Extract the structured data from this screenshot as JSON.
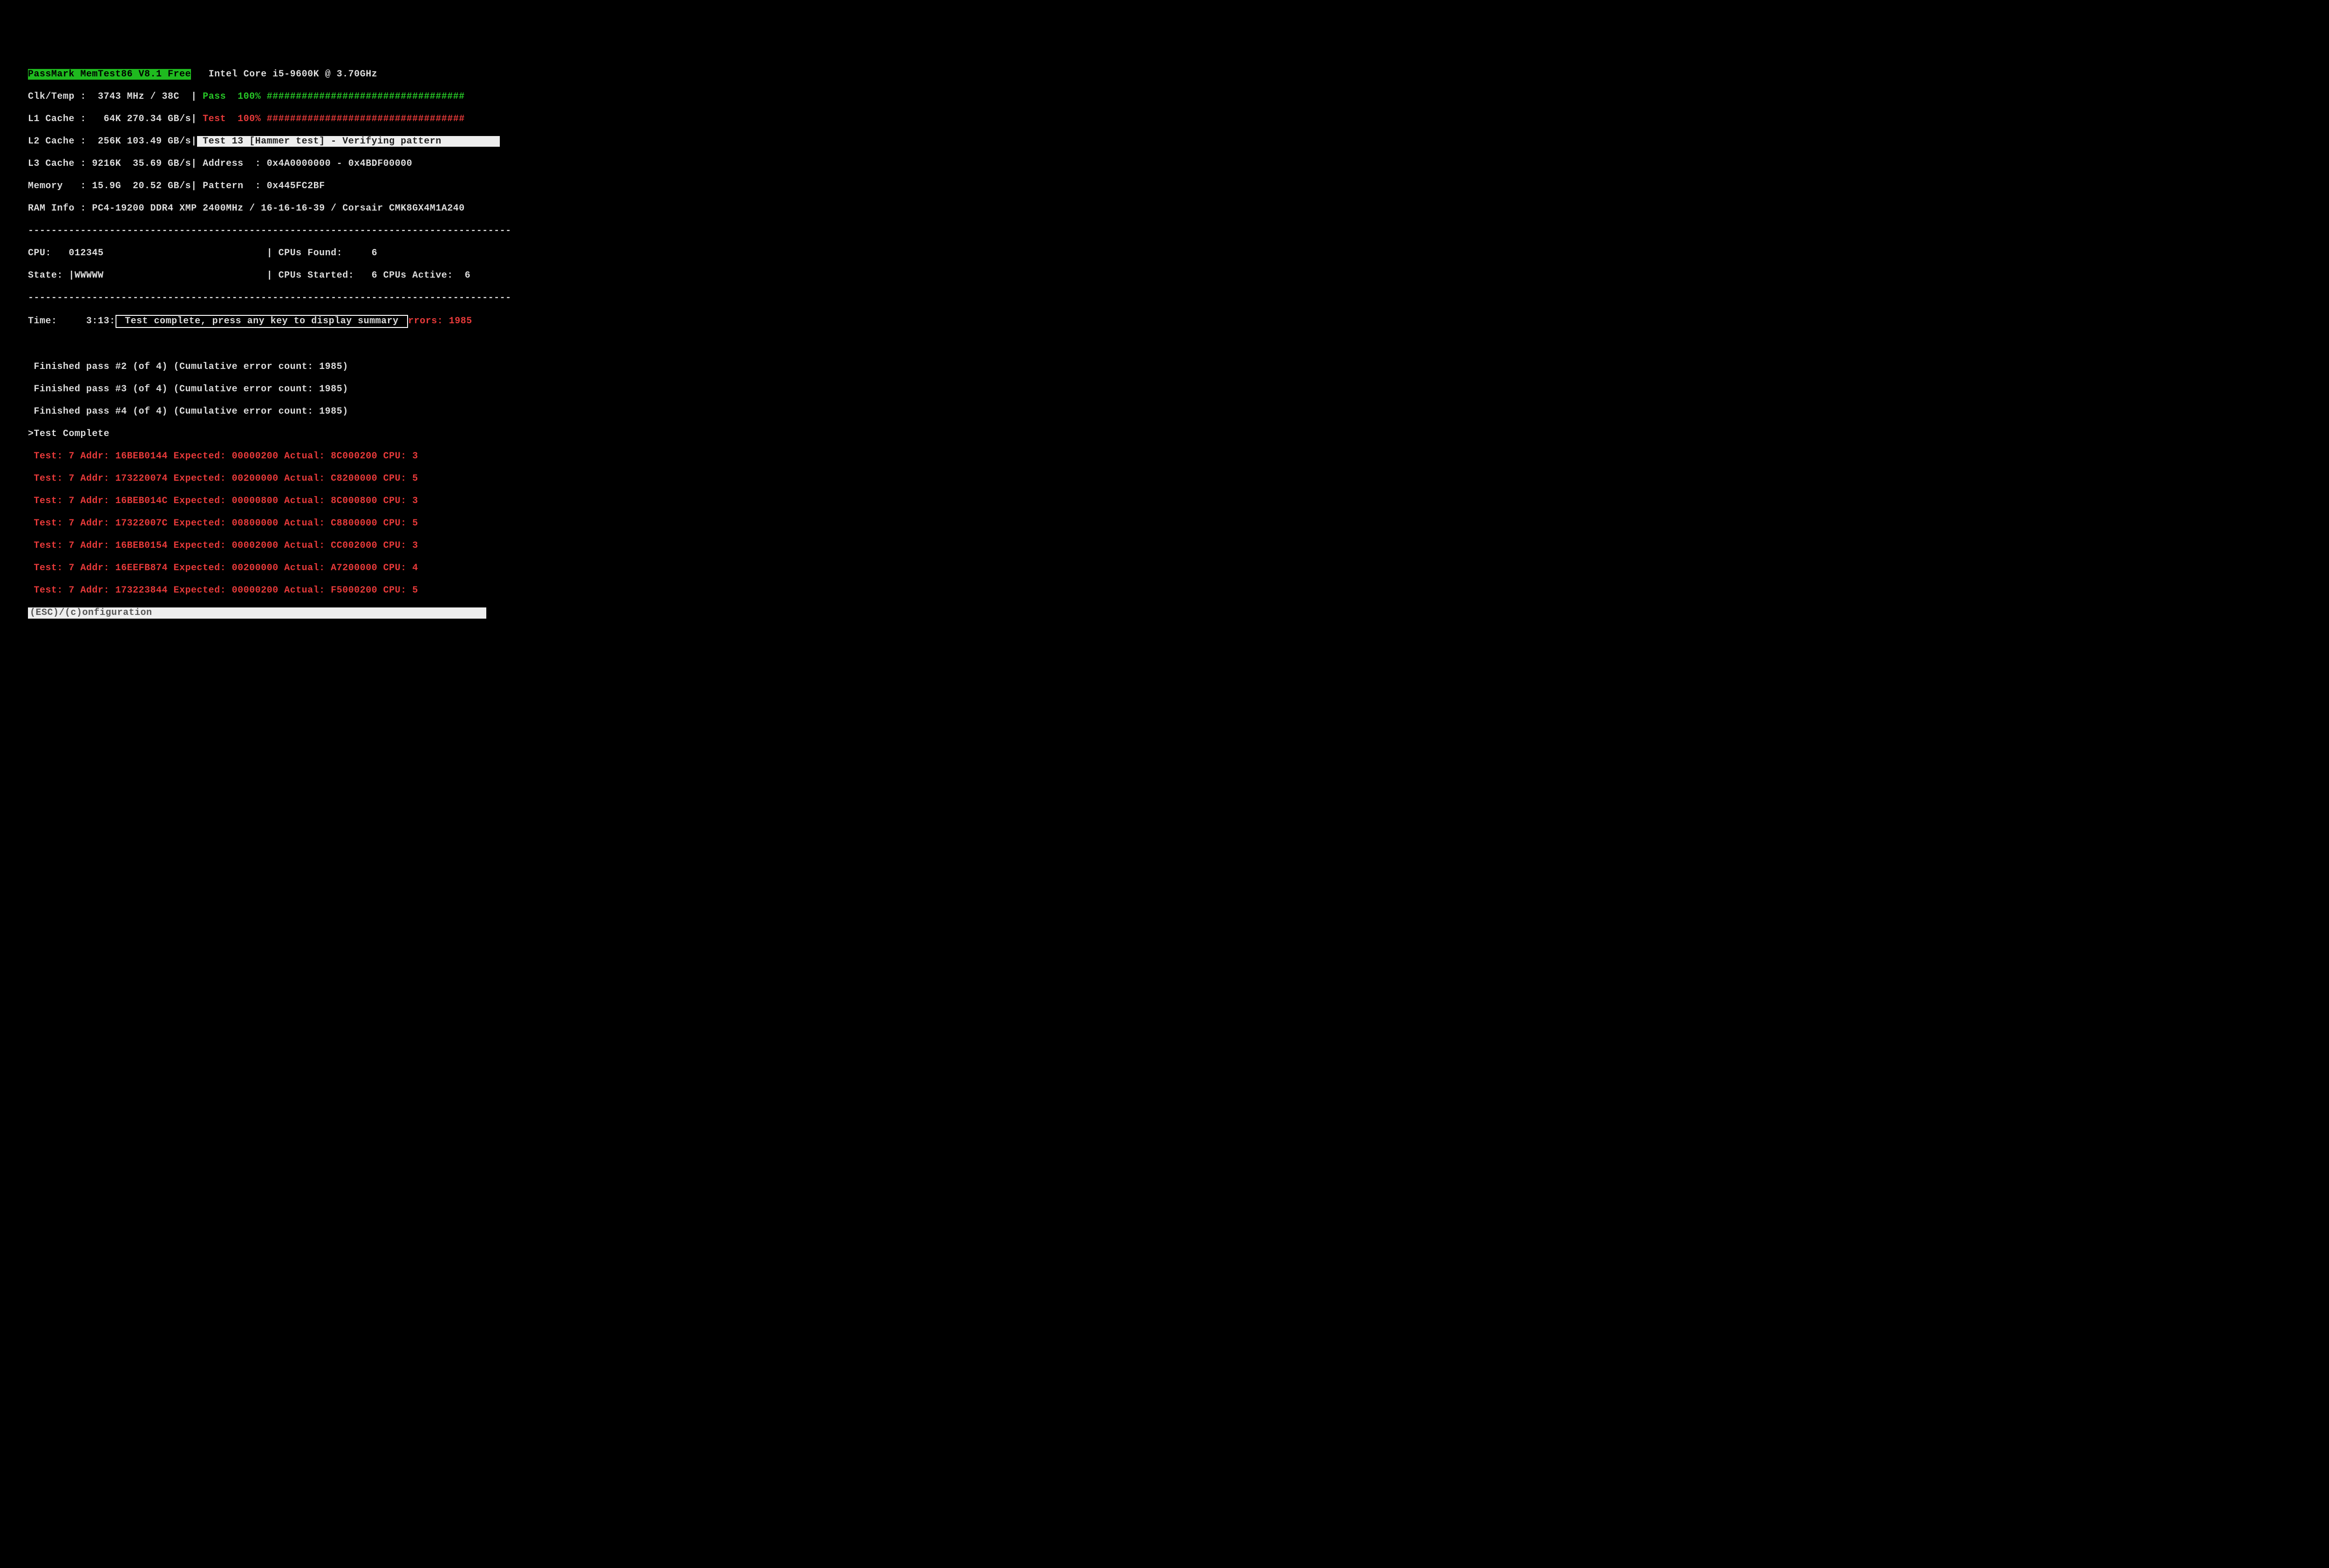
{
  "title_bar": "PassMark MemTest86 V8.1 Free",
  "cpu_name": "Intel Core i5-9600K @ 3.70GHz",
  "clk_temp_label": "Clk/Temp :",
  "clk_temp_value": "  3743 MHz / 38C",
  "l1_label": "L1 Cache :",
  "l1_value": "   64K 270.34 GB/s",
  "l2_label": "L2 Cache :",
  "l2_value": "  256K 103.49 GB/s",
  "l3_label": "L3 Cache :",
  "l3_value": " 9216K  35.69 GB/s",
  "mem_label": "Memory   :",
  "mem_value": " 15.9G  20.52 GB/s",
  "ram_label": "RAM Info :",
  "ram_value": " PC4-19200 DDR4 XMP 2400MHz / 16-16-16-39 / Corsair CMK8GX4M1A240",
  "pass_label": "Pass",
  "pass_pct": "  100%",
  "pass_bar": " ##################################",
  "test_label": "Test",
  "test_pct": "  100%",
  "test_bar": " ##################################",
  "test_status": " Test 13 [Hammer test] - Verifying pattern          ",
  "addr_line": " Address  : 0x4A0000000 - 0x4BDF00000",
  "patt_line": " Pattern  : 0x445FC2BF",
  "divider": "-----------------------------------------------------------------------------------",
  "cpu_row_left": "CPU:   012345",
  "state_row_left": "State: |WWWWW",
  "cpus_found_label": "| CPUs Found:",
  "cpus_found_value": "     6",
  "cpus_started_label": "| CPUs Started:",
  "cpus_started_value": "   6",
  "cpus_active_label": " CPUs Active:",
  "cpus_active_value": "  6",
  "time_label": "Time:",
  "time_value": "     3:13:",
  "prompt_box": " Test complete, press any key to display summary ",
  "errors_label": "rrors:",
  "errors_value": " 1985",
  "pass2": " Finished pass #2 (of 4) (Cumulative error count: 1985)",
  "pass3": " Finished pass #3 (of 4) (Cumulative error count: 1985)",
  "pass4": " Finished pass #4 (of 4) (Cumulative error count: 1985)",
  "complete_marker": ">Test Complete",
  "errors": [
    " Test: 7 Addr: 16BEB0144 Expected: 00000200 Actual: 8C000200 CPU: 3",
    " Test: 7 Addr: 173220074 Expected: 00200000 Actual: C8200000 CPU: 5",
    " Test: 7 Addr: 16BEB014C Expected: 00000800 Actual: 8C000800 CPU: 3",
    " Test: 7 Addr: 17322007C Expected: 00800000 Actual: C8800000 CPU: 5",
    " Test: 7 Addr: 16BEB0154 Expected: 00002000 Actual: CC002000 CPU: 3",
    " Test: 7 Addr: 16EEFB874 Expected: 00200000 Actual: A7200000 CPU: 4",
    " Test: 7 Addr: 173223844 Expected: 00000200 Actual: F5000200 CPU: 5"
  ],
  "footer": "(ESC)/(c)onfiguration"
}
